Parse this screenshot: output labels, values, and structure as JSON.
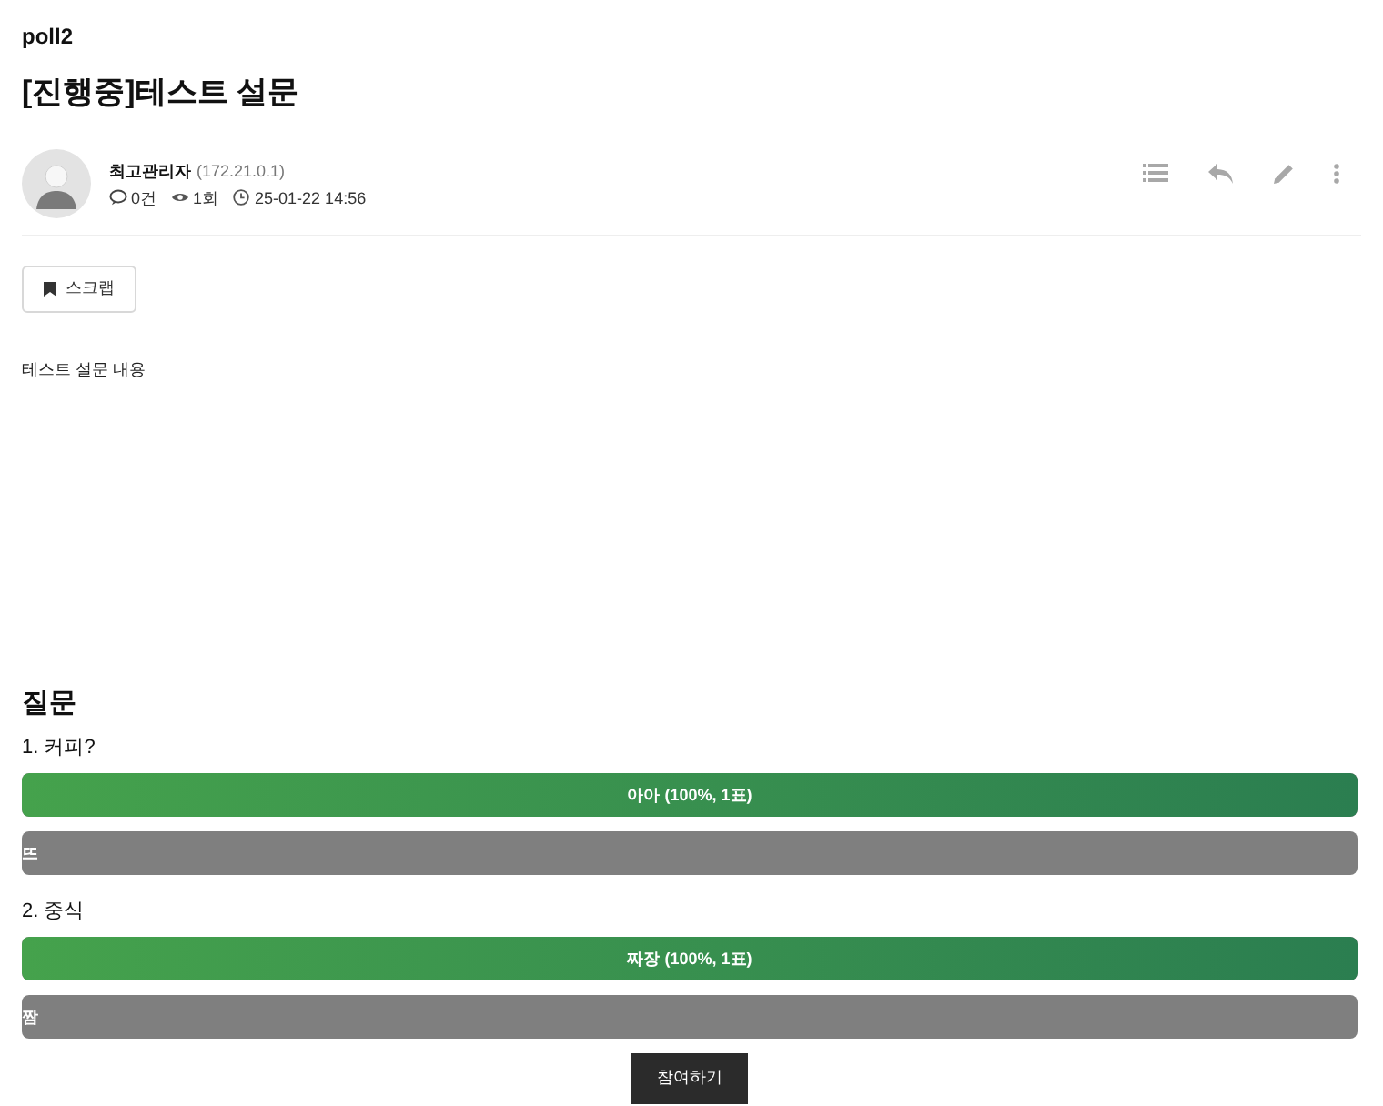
{
  "board": "poll2",
  "title": "[진행중]테스트 설문",
  "author": {
    "name": "최고관리자",
    "ip": "(172.21.0.1)"
  },
  "meta": {
    "comments": "0건",
    "views": "1회",
    "date": "25-01-22 14:56"
  },
  "scrap_button": "스크랩",
  "content": "테스트 설문 내용",
  "poll": {
    "heading": "질문",
    "questions": [
      {
        "title": "1. 커피?",
        "options": [
          {
            "label": "아아 (100%, 1표)",
            "level": 1
          },
          {
            "label": "뜨",
            "level": 0
          }
        ]
      },
      {
        "title": "2. 중식",
        "options": [
          {
            "label": "짜장 (100%, 1표)",
            "level": 1
          },
          {
            "label": "짬",
            "level": 0
          }
        ]
      }
    ],
    "submit": "참여하기"
  }
}
